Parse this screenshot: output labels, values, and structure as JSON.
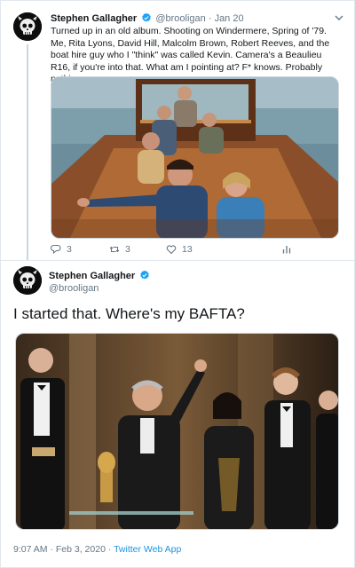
{
  "colors": {
    "accent": "#1da1f2",
    "secondary_text": "#657786",
    "border": "#e1e8ed"
  },
  "tweet1": {
    "author_name": "Stephen Gallagher",
    "handle": "@brooligan",
    "separator": "·",
    "date": "Jan 20",
    "text": "Turned up in an old album. Shooting on Windermere, Spring of '79. Me, Rita Lyons, David Hill, Malcolm Brown, Robert Reeves, and the boat hire guy who I \"think\" was called Kevin. Camera's a Beaulieu R16, if you're into that. What am I pointing at? F* knows. Probably nothing.",
    "actions": {
      "reply_count": "3",
      "retweet_count": "3",
      "like_count": "13"
    },
    "icons": [
      "reply-icon",
      "retweet-icon",
      "like-icon",
      "analytics-icon",
      "chevron-down-icon",
      "verified-icon"
    ]
  },
  "tweet2": {
    "author_name": "Stephen Gallagher",
    "handle": "@brooligan",
    "text": "I started that. Where's my BAFTA?",
    "time": "9:07 AM",
    "separator": "·",
    "date": "Feb 3, 2020",
    "source": "Twitter Web App"
  }
}
